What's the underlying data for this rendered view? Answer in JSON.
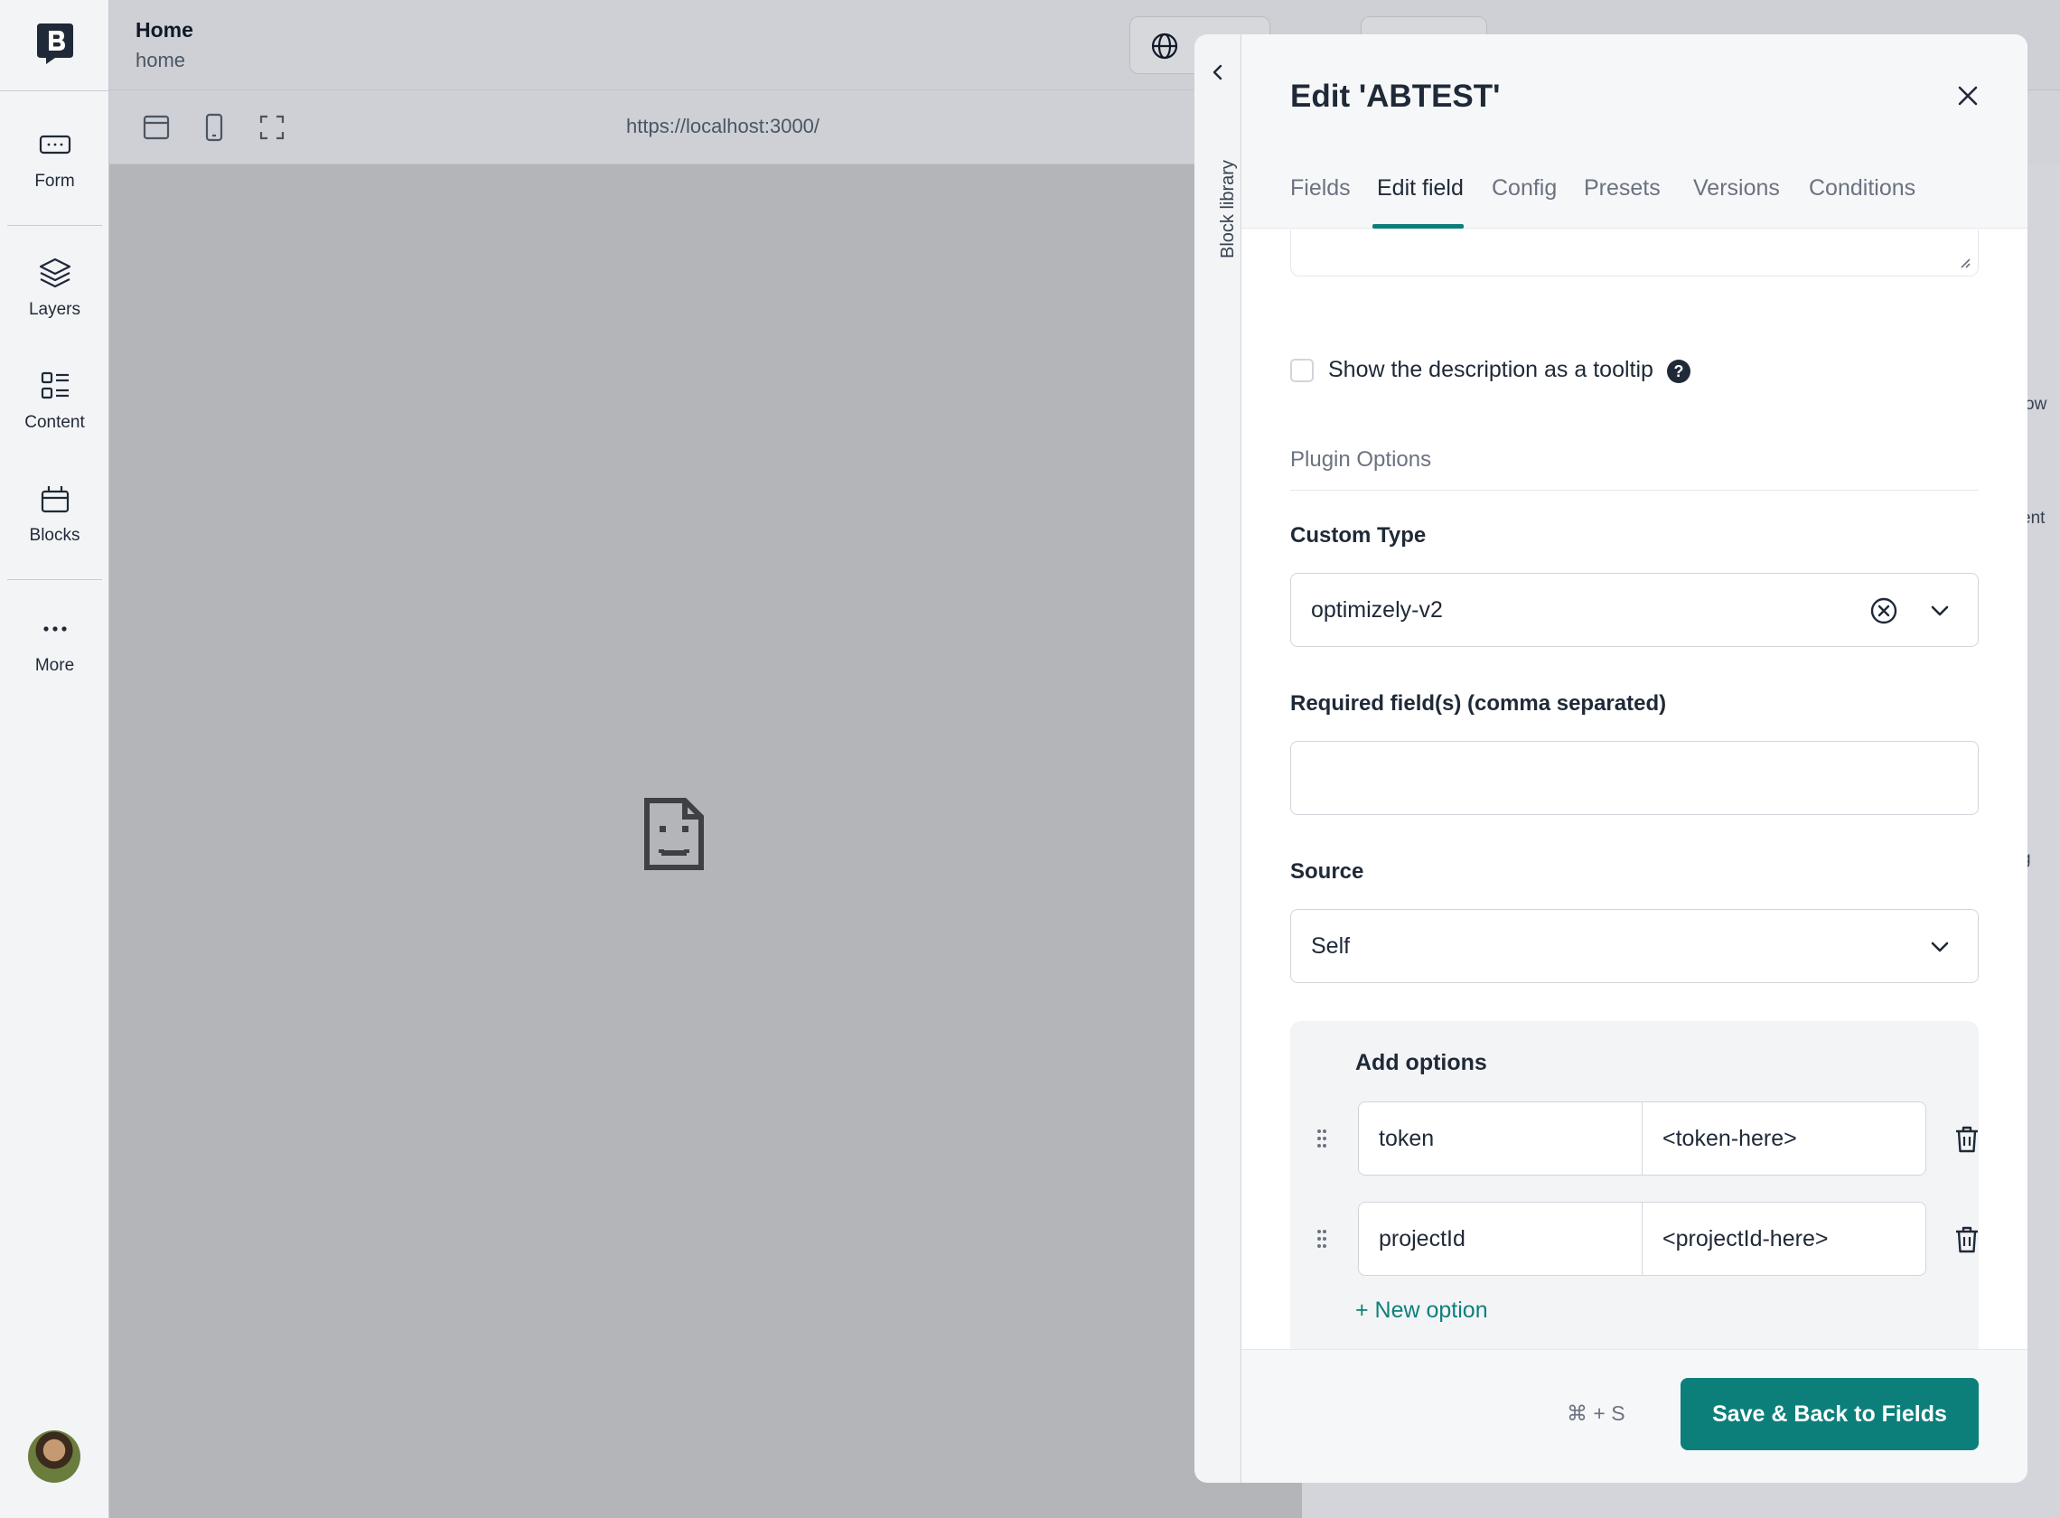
{
  "rail": {
    "items": [
      {
        "label": "Form",
        "icon": "form-icon"
      },
      {
        "label": "Layers",
        "icon": "layers-icon"
      },
      {
        "label": "Content",
        "icon": "content-icon"
      },
      {
        "label": "Blocks",
        "icon": "blocks-icon"
      },
      {
        "label": "More",
        "icon": "more-icon"
      }
    ]
  },
  "header": {
    "title": "Home",
    "subtitle": "home"
  },
  "toolbar": {
    "url": "https://localhost:3000/"
  },
  "background_fragments": [
    "ow",
    "ent",
    "g"
  ],
  "block_library": {
    "label": "Block library"
  },
  "panel": {
    "title": "Edit 'ABTEST'",
    "tabs": [
      "Fields",
      "Edit field",
      "Config",
      "Presets",
      "Versions",
      "Conditions"
    ],
    "active_tab": "Edit field",
    "tooltip_checkbox": {
      "label": "Show the description as a tooltip",
      "checked": false,
      "help": "?"
    },
    "section_title": "Plugin Options",
    "custom_type": {
      "label": "Custom Type",
      "value": "optimizely-v2"
    },
    "required_fields": {
      "label": "Required field(s) (comma separated)",
      "value": ""
    },
    "source": {
      "label": "Source",
      "value": "Self"
    },
    "options": {
      "title": "Add options",
      "rows": [
        {
          "key": "token",
          "value": "<token-here>"
        },
        {
          "key": "projectId",
          "value": "<projectId-here>"
        }
      ],
      "new_option": "+ New option"
    },
    "footer": {
      "shortcut": "⌘ + S",
      "save_label": "Save & Back to Fields"
    }
  },
  "colors": {
    "accent": "#0d7f7a",
    "dark": "#1f2937"
  }
}
